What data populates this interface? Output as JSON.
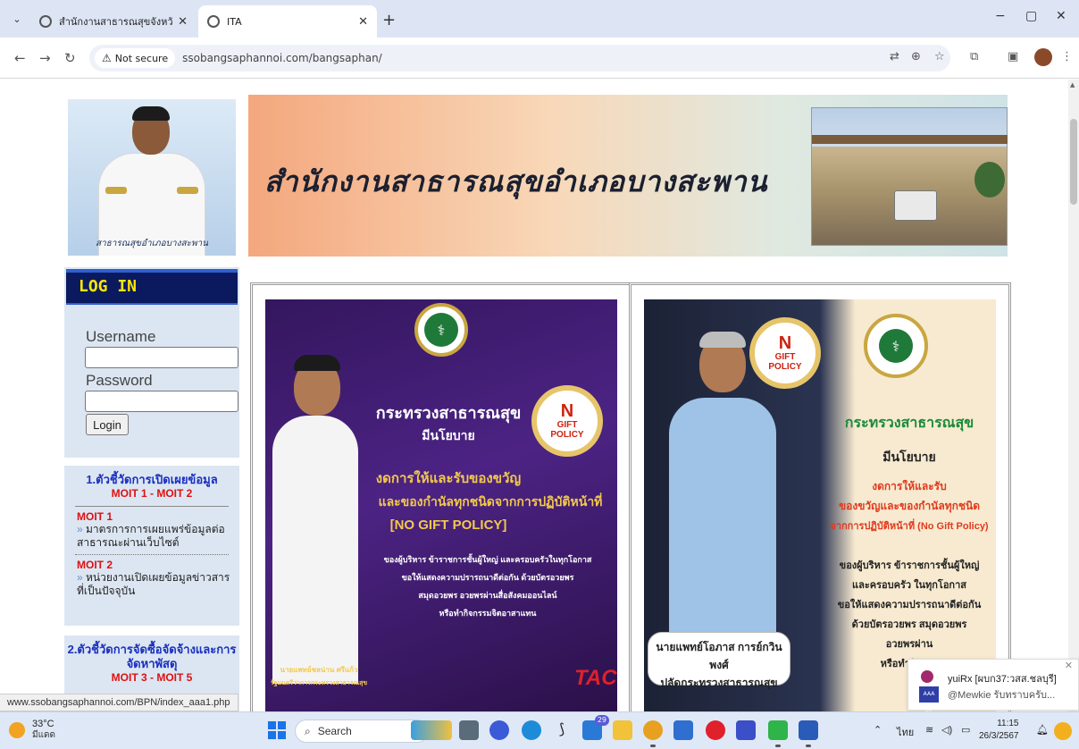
{
  "browser": {
    "tabs": [
      {
        "title": "สำนักงานสาธารณสุขจังหวัดประจวบคี",
        "active": false
      },
      {
        "title": "ITA",
        "active": true
      }
    ],
    "new_tab": "+",
    "window_controls": [
      "−",
      "▢",
      "✕"
    ],
    "address": {
      "security_label": "Not secure",
      "url": "ssobangsaphannoi.com/bangsaphan/"
    },
    "status_url": "www.ssobangsaphannoi.com/BPN/index_aaa1.php"
  },
  "page": {
    "portrait_caption": "สาธารณสุขอำเภอบางสะพาน",
    "banner_title": "สำนักงานสาธารณสุขอำเภอบางสะพาน",
    "login": {
      "header": "LOG IN",
      "username_label": "Username",
      "password_label": "Password",
      "button": "Login"
    },
    "indicators": [
      {
        "title": "1.ตัวชี้วัดการเปิดเผยข้อมูล",
        "range": "MOIT 1 - MOIT 2",
        "items": [
          {
            "code": "MOIT 1",
            "text": "มาตรการการเผยแพร่ข้อมูลต่อสาธารณะผ่านเว็บไซต์"
          },
          {
            "code": "MOIT 2",
            "text": "หน่วยงานเปิดเผยข้อมูลข่าวสารที่เป็นปัจจุบัน"
          }
        ]
      },
      {
        "title": "2.ตัวชี้วัดการจัดซื้อจัดจ้างและการจัดหาพัสดุ",
        "range": "MOIT 3 - MOIT 5"
      }
    ],
    "poster_left": {
      "ministry": "กระทรวงสาธารณสุข",
      "policy_intro": "มีนโยบาย",
      "line1": "งดการให้และรับของขวัญ",
      "line2": "และของกำนัลทุกชนิดจากการปฏิบัติหน้าที่",
      "line3": "[NO GIFT POLICY]",
      "body1": "ของผู้บริหาร ข้าราชการชั้นผู้ใหญ่ และครอบครัวในทุกโอกาส",
      "body2": "ขอให้แสดงความปรารถนาดีต่อกัน ด้วยบัตรอวยพร",
      "body3": "สมุดอวยพร อวยพรผ่านสื่อสังคมออนไลน์",
      "body4": "หรือทำกิจกรรมจิตอาสาแทน",
      "person_name": "นายแพทย์ชลน่าน ศรีแก้ว",
      "person_title": "รัฐมนตรีว่าการกระทรวงสาธารณสุข",
      "badge_no": "N",
      "badge_gift": "GIFT",
      "badge_policy": "POLICY",
      "brand": "TAC"
    },
    "poster_right": {
      "ministry": "กระทรวงสาธารณสุข",
      "policy_intro": "มีนโยบาย",
      "line1": "งดการให้และรับ",
      "line2": "ของขวัญและของกำนัลทุกชนิด",
      "line3": "จากการปฏิบัติหน้าที่ (No Gift Policy)",
      "body1": "ของผู้บริหาร ข้าราชการชั้นผู้ใหญ่",
      "body2": "และครอบครัว ในทุกโอกาส",
      "body3": "ขอให้แสดงความปรารถนาดีต่อกัน",
      "body4": "ด้วยบัตรอวยพร สมุดอวยพร",
      "body5": "อวยพรผ่าน",
      "body6": "หรือทำกิจกรร",
      "person_name": "นายแพทย์โอภาส การย์กวินพงศ์",
      "person_title": "ปลัดกระทรวงสาธารณสุข",
      "badge_no": "N",
      "badge_gift": "GIFT",
      "badge_policy": "POLICY"
    }
  },
  "notification": {
    "line1": "yuiRx [ผบก37:วสส.ชลบุรี]",
    "line2": "@Mewkie รับทราบครับ...",
    "thumb_text": "AAA 37"
  },
  "taskbar": {
    "weather_temp": "33°C",
    "weather_cond": "มีแดด",
    "search_label": "Search",
    "edge_badge": "29",
    "language": "ไทย",
    "time": "11:15",
    "date": "26/3/2567"
  },
  "colors": {
    "tabstrip": "#dde5f5",
    "login_header": "#0b1a5e",
    "login_header_text": "#ffe600",
    "indicator_bg": "#dce6f2",
    "moit_red": "#d11111",
    "indicator_blue": "#1a2fbf"
  }
}
